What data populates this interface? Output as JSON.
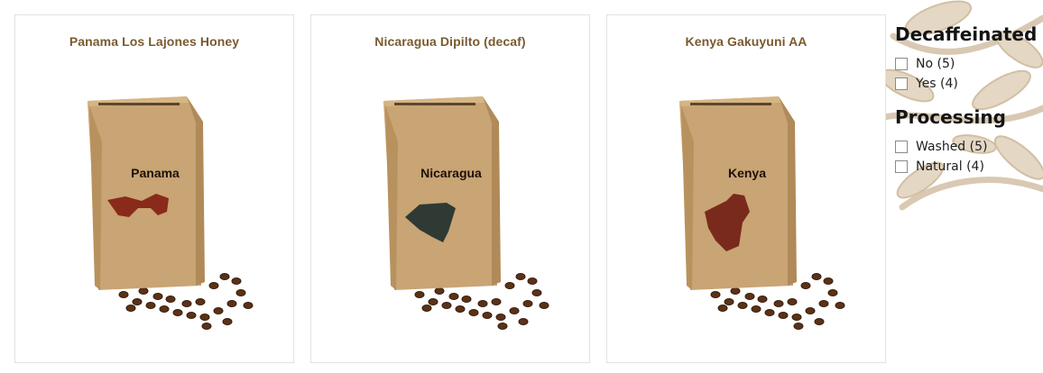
{
  "products": [
    {
      "title": "Panama Los Lajones Honey",
      "bag_label": "Panama",
      "map_color": "#8a2a1a"
    },
    {
      "title": "Nicaragua Dipilto (decaf)",
      "bag_label": "Nicaragua",
      "map_color": "#2f3a34"
    },
    {
      "title": "Kenya Gakuyuni AA",
      "bag_label": "Kenya",
      "map_color": "#7a2a1c"
    }
  ],
  "filters": {
    "decaffeinated": {
      "title": "Decaffeinated",
      "options": [
        {
          "label": "No (5)",
          "checked": false
        },
        {
          "label": "Yes (4)",
          "checked": false
        }
      ]
    },
    "processing": {
      "title": "Processing",
      "options": [
        {
          "label": "Washed (5)",
          "checked": false
        },
        {
          "label": "Natural (4)",
          "checked": false
        }
      ]
    }
  },
  "colors": {
    "title_brown": "#7a5a2e",
    "kraft_paper": "#c9a474",
    "decoration": "#d9c9b3"
  }
}
